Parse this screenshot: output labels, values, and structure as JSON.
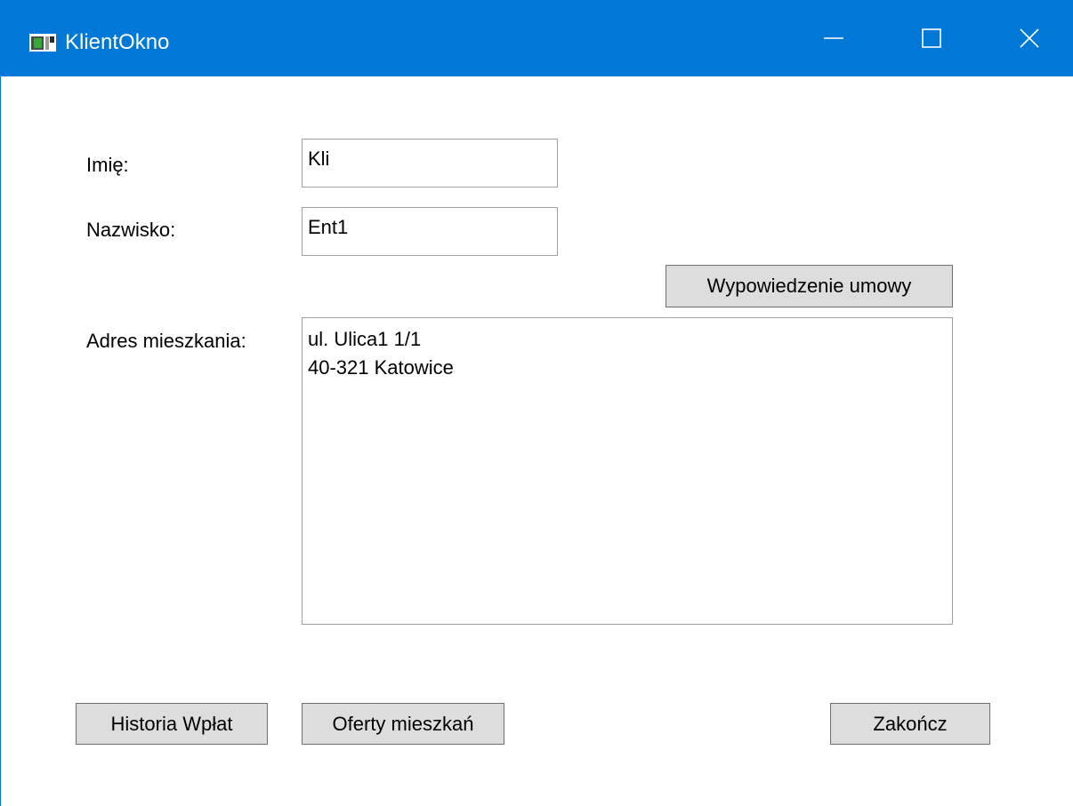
{
  "window": {
    "title": "KlientOkno",
    "accent_color": "#0078d7",
    "icons": {
      "app": "window-app-icon",
      "minimize": "minimize-icon",
      "maximize": "maximize-icon",
      "close": "close-icon"
    }
  },
  "form": {
    "first_name": {
      "label": "Imię:",
      "value": "Kli"
    },
    "last_name": {
      "label": "Nazwisko:",
      "value": "Ent1"
    },
    "terminate_button": "Wypowiedzenie umowy",
    "address": {
      "label": "Adres mieszkania:",
      "lines": [
        "ul. Ulica1 1/1",
        "40-321 Katowice"
      ]
    }
  },
  "footer": {
    "payment_history_button": "Historia Wpłat",
    "apartment_offers_button": "Oferty mieszkań",
    "finish_button": "Zakończ"
  }
}
